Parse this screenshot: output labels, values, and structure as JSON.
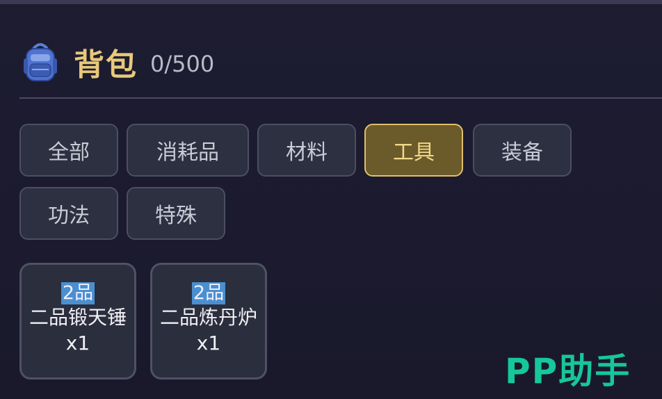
{
  "header": {
    "title": "背包",
    "count": "0/500",
    "icon": "backpack-icon"
  },
  "tabs": [
    {
      "label": "全部",
      "active": false
    },
    {
      "label": "消耗品",
      "active": false
    },
    {
      "label": "材料",
      "active": false
    },
    {
      "label": "工具",
      "active": true
    },
    {
      "label": "装备",
      "active": false
    },
    {
      "label": "功法",
      "active": false
    },
    {
      "label": "特殊",
      "active": false
    }
  ],
  "items": [
    {
      "grade": "2品",
      "name": "二品锻天锤",
      "qty": "x1"
    },
    {
      "grade": "2品",
      "name": "二品炼丹炉",
      "qty": "x1"
    }
  ],
  "watermark": "PP助手",
  "colors": {
    "accent_gold": "#e2c06a",
    "watermark_green": "#16c79a",
    "background": "#1b1a2e"
  }
}
